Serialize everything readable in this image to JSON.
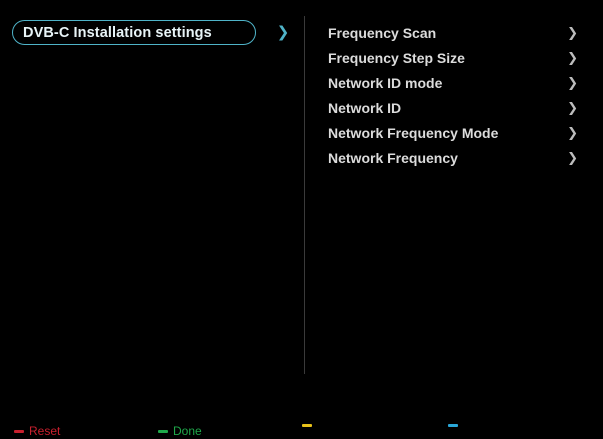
{
  "left_menu": {
    "selected_label": "DVB-C Installation settings"
  },
  "right_menu": {
    "items": [
      {
        "label": "Frequency Scan"
      },
      {
        "label": "Frequency Step Size"
      },
      {
        "label": "Network ID mode"
      },
      {
        "label": "Network ID"
      },
      {
        "label": "Network Frequency Mode"
      },
      {
        "label": "Network Frequency"
      }
    ]
  },
  "key_bar": {
    "red": {
      "label": "Reset",
      "color": "#c8202e"
    },
    "green": {
      "label": "Done",
      "color": "#1fa84a"
    },
    "yellow": {
      "label": "",
      "color": "#e8c21a"
    },
    "blue": {
      "label": "",
      "color": "#2aa7d8"
    }
  },
  "colors": {
    "accent": "#4fb3c8",
    "background": "#000000"
  },
  "icons": {
    "submenu_indicator": "chevron-right-icon"
  }
}
